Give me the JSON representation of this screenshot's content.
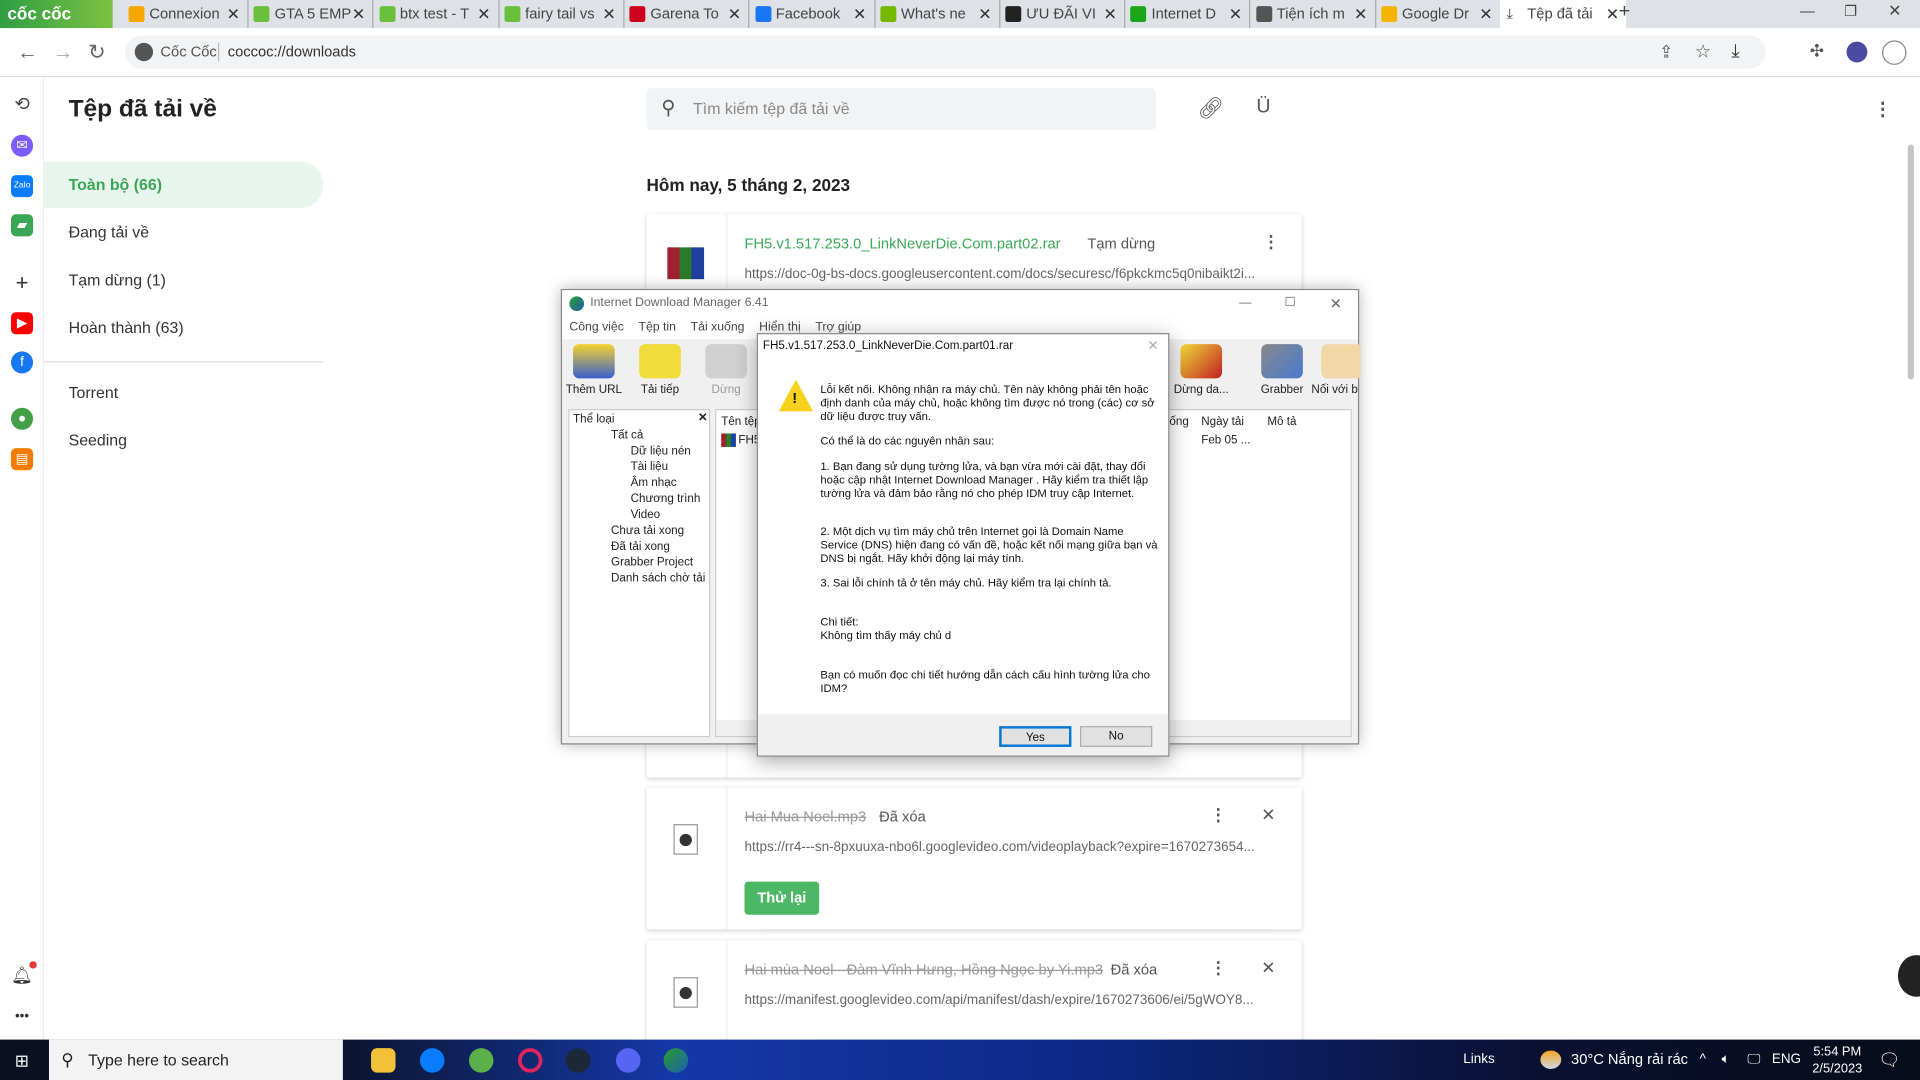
{
  "browser": {
    "logo": "cốc cốc",
    "tabs": [
      {
        "label": "Connexion",
        "color": "#f6a800"
      },
      {
        "label": "GTA 5 EMP",
        "color": "#6bbf3a"
      },
      {
        "label": "btx test - T",
        "color": "#6bbf3a"
      },
      {
        "label": "fairy tail vs",
        "color": "#6bbf3a"
      },
      {
        "label": "Garena To",
        "color": "#d0021b"
      },
      {
        "label": "Facebook",
        "color": "#1877f2"
      },
      {
        "label": "What's ne",
        "color": "#76b900"
      },
      {
        "label": "ƯU ĐÃI VI",
        "color": "#222222"
      },
      {
        "label": "Internet D",
        "color": "#1aa619"
      },
      {
        "label": "Tiện ích m",
        "color": "#555555"
      },
      {
        "label": "Google Dr",
        "color": "#f4b400"
      },
      {
        "label": "Tệp đã tải",
        "color": "#555555"
      }
    ],
    "address_site": "Cốc Cốc",
    "address_url": "coccoc://downloads"
  },
  "sidebar": {
    "title": "Tệp đã tải về",
    "items": [
      {
        "label": "Toàn bộ (66)"
      },
      {
        "label": "Đang tải về"
      },
      {
        "label": "Tạm dừng (1)"
      },
      {
        "label": "Hoàn thành (63)"
      },
      {
        "label": "Torrent"
      },
      {
        "label": "Seeding"
      }
    ]
  },
  "search": {
    "placeholder": "Tìm kiếm tệp đã tải về"
  },
  "main": {
    "date_header": "Hôm nay, 5 tháng 2, 2023",
    "downloads": [
      {
        "name": "FH5.v1.517.253.0_LinkNeverDie.Com.part02.rar",
        "status": "Tạm dừng",
        "url": "https://doc-0g-bs-docs.googleusercontent.com/docs/securesc/f6pkckmc5q0nibaikt2i..."
      },
      {
        "name": "Hai Mua Noel.mp3",
        "status": "Đã xóa",
        "url": "https://rr4---sn-8pxuuxa-nbo6l.googlevideo.com/videoplayback?expire=1670273654...",
        "retry": "Thử lại"
      },
      {
        "name": "Hai mùa Noel - Đàm Vĩnh Hưng, Hồng Ngọc by Yi.mp3",
        "status": "Đã xóa",
        "url": "https://manifest.googlevideo.com/api/manifest/dash/expire/1670273606/ei/5gWOY8..."
      }
    ]
  },
  "idm": {
    "title": "Internet Download Manager 6.41",
    "menu": [
      "Công việc",
      "Tệp tin",
      "Tải xuống",
      "Hiển thị",
      "Trợ giúp"
    ],
    "toolbar": [
      "Thêm URL",
      "Tải tiếp",
      "Dừng",
      "Dừng da...",
      "Grabber",
      "Nối với b"
    ],
    "tree_header": "Thể loại",
    "tree": [
      "Tất cả",
      "Dữ liệu nén",
      "Tài liệu",
      "Âm nhạc",
      "Chương trình",
      "Video",
      "Chưa tải xong",
      "Đã tải xong",
      "Grabber Project",
      "Danh sách chờ tải"
    ],
    "columns": [
      "Tên tệp",
      "ống",
      "Ngày tải",
      "Mô tả"
    ],
    "row": {
      "name": "FH5",
      "date": "Feb 05 ..."
    }
  },
  "dialog": {
    "title": "FH5.v1.517.253.0_LinkNeverDie.Com.part01.rar",
    "message": "Lỗi kết nối. Không nhận ra máy chủ. Tên này không phải tên hoặc định danh của máy chủ, hoặc không tìm được nó trong (các) cơ sở dữ liệu được truy vấn.",
    "causes_intro": "Có thể là do các nguyên nhân sau:",
    "cause1": "1. Bạn đang sử dụng tường lửa, và bạn vừa mới cài đặt, thay đổi hoặc cập nhật Internet Download Manager . Hãy kiểm tra thiết lập tường lửa và đảm bảo rằng nó cho phép IDM truy cập Internet.",
    "cause2": "2. Một dịch vụ tìm máy chủ trên Internet gọi là Domain Name Service (DNS) hiện đang có vấn đề, hoặc kết nối mạng giữa bạn và DNS bị ngắt. Hãy khởi động lại máy tính.",
    "cause3": "3. Sai lỗi chính tả ở tên máy chủ. Hãy kiểm tra lại chính tả.",
    "details_label": "Chi tiết:",
    "details": "Không tìm thấy máy chủ d",
    "question": "Bạn có muốn đọc chi tiết hướng dẫn cách cấu hình tường lửa cho IDM?",
    "yes": "Yes",
    "no": "No"
  },
  "taskbar": {
    "search_placeholder": "Type here to search",
    "links": "Links",
    "weather": "30°C  Nắng rải rác",
    "lang": "ENG",
    "time": "5:54 PM",
    "date": "2/5/2023"
  },
  "colors": {
    "accent": "#3aa757",
    "retry_button": "#4cb865",
    "taskbar": "#0d2a8a"
  }
}
